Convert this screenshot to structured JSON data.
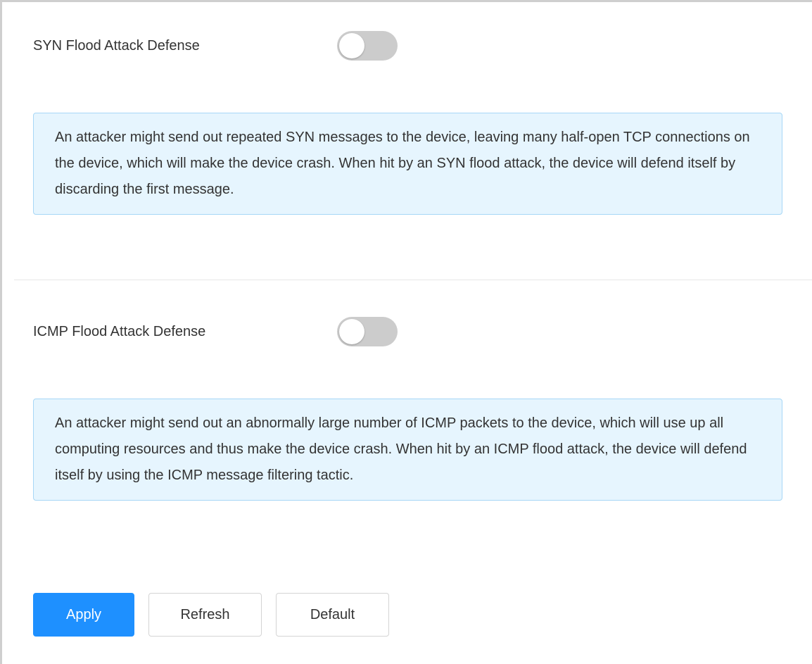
{
  "syn": {
    "label": "SYN Flood Attack Defense",
    "enabled": false,
    "description": "An attacker might send out repeated SYN messages to the device, leaving many half-open TCP connections on the device, which will make the device crash. When hit by an SYN flood attack, the device will defend itself by discarding the first message."
  },
  "icmp": {
    "label": "ICMP Flood Attack Defense",
    "enabled": false,
    "description": "An attacker might send out an abnormally large number of ICMP packets to the device, which will use up all computing resources and thus make the device crash. When hit by an ICMP flood attack, the device will defend itself by using the ICMP message filtering tactic."
  },
  "actions": {
    "apply_label": "Apply",
    "refresh_label": "Refresh",
    "default_label": "Default"
  },
  "colors": {
    "primary": "#1e90ff",
    "info_background": "#e6f5fe",
    "info_border": "#a7d7f6",
    "toggle_off": "#cccccc"
  }
}
